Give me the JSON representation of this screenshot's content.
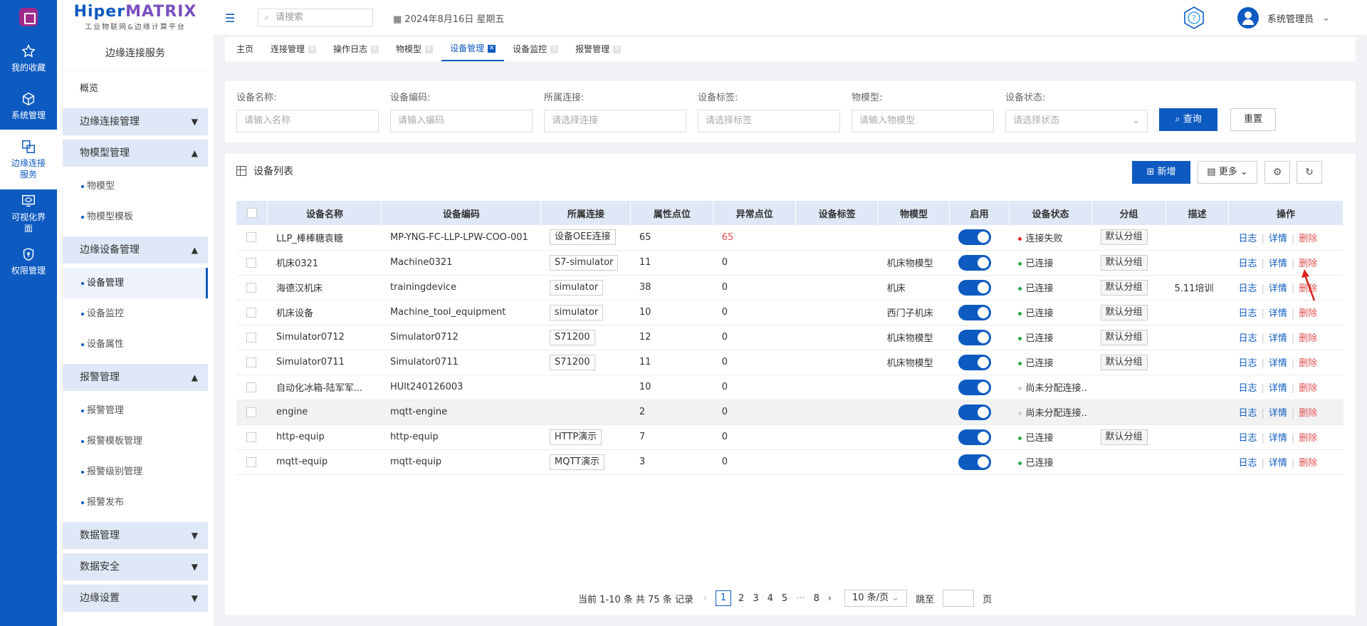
{
  "rail": {
    "items": [
      {
        "label": "我的收藏",
        "icon": "star-icon"
      },
      {
        "label": "系统管理",
        "icon": "cube-icon"
      },
      {
        "label": "边缘连接\n服务",
        "icon": "link-icon",
        "active": true
      },
      {
        "label": "可视化界\n面",
        "icon": "monitor-eye-icon"
      },
      {
        "label": "权限管理",
        "icon": "shield-icon"
      }
    ]
  },
  "brand": {
    "name_a": "Hiper",
    "name_b": "MATRIX",
    "tagline": "工业物联网&边缘计算平台"
  },
  "sidebar": {
    "title": "边缘连接服务",
    "overview": "概览",
    "g1": "边缘连接管理",
    "g2": "物模型管理",
    "g2_items": [
      "物模型",
      "物模型模板"
    ],
    "g3": "边缘设备管理",
    "g3_items": [
      "设备管理",
      "设备监控",
      "设备属性"
    ],
    "g4": "报警管理",
    "g4_items": [
      "报警管理",
      "报警模板管理",
      "报警级别管理",
      "报警发布"
    ],
    "g5": "数据管理",
    "g6": "数据安全",
    "g7": "边缘设置"
  },
  "topbar": {
    "search_placeholder": "请搜索",
    "date": "2024年8月16日 星期五",
    "user": "系统管理员"
  },
  "tabs": [
    {
      "label": "主页",
      "close": false
    },
    {
      "label": "连接管理",
      "close": true
    },
    {
      "label": "操作日志",
      "close": true
    },
    {
      "label": "物模型",
      "close": true
    },
    {
      "label": "设备管理",
      "close": true,
      "active": true
    },
    {
      "label": "设备监控",
      "close": true
    },
    {
      "label": "报警管理",
      "close": true
    }
  ],
  "filter": {
    "f1": {
      "label": "设备名称:",
      "ph": "请输入名称"
    },
    "f2": {
      "label": "设备编码:",
      "ph": "请输入编码"
    },
    "f3": {
      "label": "所属连接:",
      "ph": "请选择连接"
    },
    "f4": {
      "label": "设备标签:",
      "ph": "请选择标签"
    },
    "f5": {
      "label": "物模型:",
      "ph": "请输入物模型"
    },
    "f6": {
      "label": "设备状态:",
      "ph": "请选择状态"
    },
    "query": "查询",
    "reset": "重置"
  },
  "panel": {
    "title": "设备列表",
    "add": "新增",
    "more": "更多"
  },
  "table": {
    "headers": [
      "设备名称",
      "设备编码",
      "所属连接",
      "属性点位",
      "异常点位",
      "设备标签",
      "物模型",
      "启用",
      "设备状态",
      "分组",
      "描述",
      "操作"
    ],
    "ops": {
      "log": "日志",
      "detail": "详情",
      "del": "删除"
    },
    "rows": [
      {
        "name": "LLP_棒棒糖袁糖",
        "code": "MP-YNG-FC-LLP-LPW-COO-001",
        "conn": "设备OEE连接",
        "attr": "65",
        "err": "65",
        "tag": "",
        "model": "",
        "status": "连接失败",
        "status_color": "#e03030",
        "group": "默认分组",
        "desc": ""
      },
      {
        "name": "机床0321",
        "code": "Machine0321",
        "conn": "S7-simulator",
        "attr": "11",
        "err": "0",
        "tag": "",
        "model": "机床物模型",
        "status": "已连接",
        "status_color": "#2aa84a",
        "group": "默认分组",
        "desc": ""
      },
      {
        "name": "海德汉机床",
        "code": "trainingdevice",
        "conn": "simulator",
        "attr": "38",
        "err": "0",
        "tag": "",
        "model": "机床",
        "status": "已连接",
        "status_color": "#2aa84a",
        "group": "默认分组",
        "desc": "5.11培训"
      },
      {
        "name": "机床设备",
        "code": "Machine_tool_equipment",
        "conn": "simulator",
        "attr": "10",
        "err": "0",
        "tag": "",
        "model": "西门子机床",
        "status": "已连接",
        "status_color": "#2aa84a",
        "group": "默认分组",
        "desc": ""
      },
      {
        "name": "Simulator0712",
        "code": "Simulator0712",
        "conn": "S71200",
        "attr": "12",
        "err": "0",
        "tag": "",
        "model": "机床物模型",
        "status": "已连接",
        "status_color": "#2aa84a",
        "group": "默认分组",
        "desc": ""
      },
      {
        "name": "Simulator0711",
        "code": "Simulator0711",
        "conn": "S71200",
        "attr": "11",
        "err": "0",
        "tag": "",
        "model": "机床物模型",
        "status": "已连接",
        "status_color": "#2aa84a",
        "group": "默认分组",
        "desc": ""
      },
      {
        "name": "自动化冰箱-陆军军...",
        "code": "HUlt240126003",
        "conn": "",
        "attr": "10",
        "err": "0",
        "tag": "",
        "model": "",
        "status": "尚未分配连接..",
        "status_color": "#cccccc",
        "group": "",
        "desc": ""
      },
      {
        "name": "engine",
        "code": "mqtt-engine",
        "conn": "",
        "attr": "2",
        "err": "0",
        "tag": "",
        "model": "",
        "status": "尚未分配连接..",
        "status_color": "#cccccc",
        "group": "",
        "desc": "",
        "hl": true
      },
      {
        "name": "http-equip",
        "code": "http-equip",
        "conn": "HTTP演示",
        "attr": "7",
        "err": "0",
        "tag": "",
        "model": "",
        "status": "已连接",
        "status_color": "#2aa84a",
        "group": "默认分组",
        "desc": ""
      },
      {
        "name": "mqtt-equip",
        "code": "mqtt-equip",
        "conn": "MQTT演示",
        "attr": "3",
        "err": "0",
        "tag": "",
        "model": "",
        "status": "已连接",
        "status_color": "#2aa84a",
        "group": "",
        "desc": ""
      }
    ]
  },
  "pager": {
    "summary": "当前 1-10 条 共 75 条 记录",
    "pages": [
      "1",
      "2",
      "3",
      "4",
      "5",
      "···",
      "8"
    ],
    "size": "10 条/页",
    "jump": "跳至",
    "unit": "页"
  },
  "colors": {
    "primary": "#0d5ac1",
    "danger": "#e05050"
  }
}
